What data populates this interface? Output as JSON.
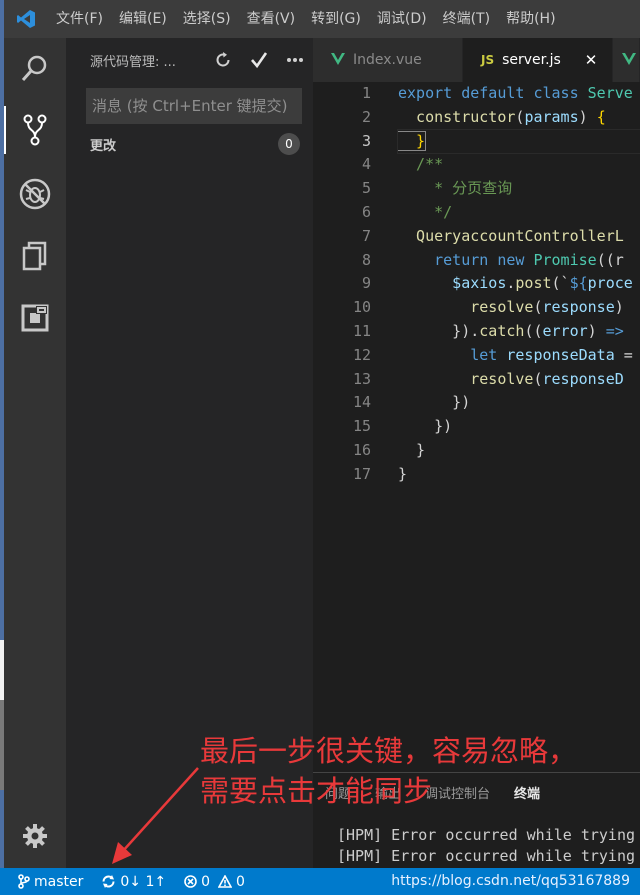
{
  "menu": {
    "items": [
      "文件(F)",
      "编辑(E)",
      "选择(S)",
      "查看(V)",
      "转到(G)",
      "调试(D)",
      "终端(T)",
      "帮助(H)"
    ]
  },
  "activity_bar": {
    "icons": [
      "files-icon",
      "search-icon",
      "source-control-icon",
      "debug-icon",
      "copy-icon",
      "extensions-icon",
      "gear-icon"
    ]
  },
  "sidebar": {
    "title": "源代码管理: ...",
    "message_placeholder": "消息 (按 Ctrl+Enter 键提交)",
    "changes_label": "更改",
    "changes_count": "0"
  },
  "tabs": [
    {
      "icon": "V",
      "label": "Index.vue",
      "active": false
    },
    {
      "icon": "JS",
      "label": "server.js",
      "active": true,
      "close": "✕"
    },
    {
      "icon": "V",
      "label": "",
      "active": false
    }
  ],
  "editor": {
    "current_line": 3,
    "lines": [
      [
        [
          "kw",
          "export "
        ],
        [
          "kw",
          "default "
        ],
        [
          "kw",
          "class "
        ],
        [
          "cls",
          "Serve"
        ]
      ],
      [
        [
          "fn",
          "  constructor"
        ],
        [
          "pun",
          "("
        ],
        [
          "var",
          "params"
        ],
        [
          "pun",
          ") "
        ],
        [
          "brk",
          "{"
        ]
      ],
      [
        [
          "brk",
          "  }"
        ]
      ],
      [
        [
          "cm",
          "  /**"
        ]
      ],
      [
        [
          "cm",
          "    * 分页查询"
        ]
      ],
      [
        [
          "cm",
          "    */"
        ]
      ],
      [
        [
          "fn",
          "  QueryaccountControllerL"
        ]
      ],
      [
        [
          "kw",
          "    return "
        ],
        [
          "kw",
          "new "
        ],
        [
          "cls",
          "Promise"
        ],
        [
          "pun",
          "((r"
        ]
      ],
      [
        [
          "var",
          "      $axios"
        ],
        [
          "pun",
          "."
        ],
        [
          "fn",
          "post"
        ],
        [
          "pun",
          "(`"
        ],
        [
          "tpl",
          "${"
        ],
        [
          "var",
          "proce"
        ]
      ],
      [
        [
          "fn",
          "        resolve"
        ],
        [
          "pun",
          "("
        ],
        [
          "var",
          "response"
        ],
        [
          "pun",
          ")"
        ]
      ],
      [
        [
          "pun",
          "      })."
        ],
        [
          "fn",
          "catch"
        ],
        [
          "pun",
          "(("
        ],
        [
          "var",
          "error"
        ],
        [
          "pun",
          ") "
        ],
        [
          "kw",
          "=>"
        ]
      ],
      [
        [
          "kw",
          "        let "
        ],
        [
          "var",
          "responseData "
        ],
        [
          "pun",
          "="
        ]
      ],
      [
        [
          "fn",
          "        resolve"
        ],
        [
          "pun",
          "("
        ],
        [
          "var",
          "responseD"
        ]
      ],
      [
        [
          "pun",
          "      })"
        ]
      ],
      [
        [
          "pun",
          "    })"
        ]
      ],
      [
        [
          "pun",
          "  }"
        ]
      ],
      [
        [
          "pun",
          "}"
        ]
      ]
    ]
  },
  "panel": {
    "tabs": [
      "问题",
      "输出",
      "调试控制台",
      "终端"
    ],
    "active_tab": "终端",
    "terminal_lines": [
      "[HPM] Error occurred while trying",
      "[HPM] Error occurred while trying"
    ]
  },
  "statusbar": {
    "branch": "master",
    "sync": "0↓ 1↑",
    "errors": "0",
    "warnings": "0",
    "watermark": "https://blog.csdn.net/qq53167889"
  },
  "annotation": {
    "line1": "最后一步很关键，容易忽略，",
    "line2": "需要点击才能同步"
  },
  "colors": {
    "accent": "#007acc",
    "annotation": "#e8393a",
    "vue_green": "#41b883",
    "js_yellow": "#cbcb41"
  }
}
